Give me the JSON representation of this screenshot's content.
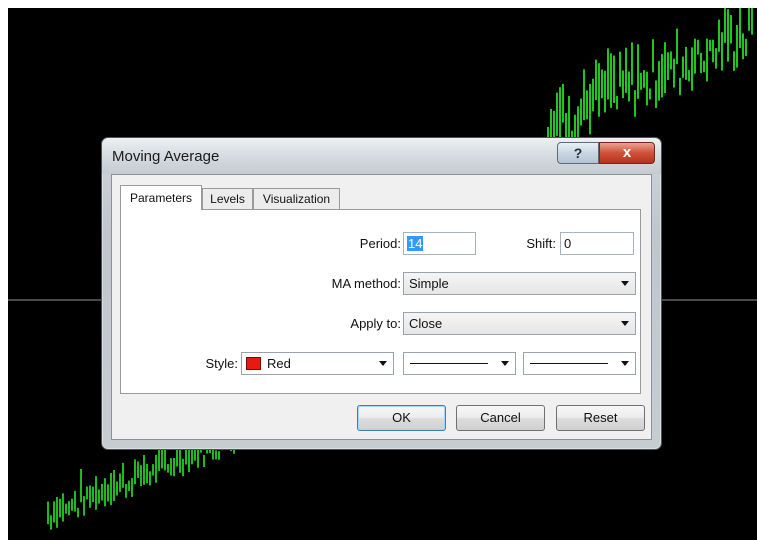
{
  "dialog": {
    "title": "Moving Average",
    "help_label": "?",
    "close_label": "x",
    "tabs": [
      {
        "label": "Parameters",
        "active": true
      },
      {
        "label": "Levels",
        "active": false
      },
      {
        "label": "Visualization",
        "active": false
      }
    ],
    "params": {
      "period_label": "Period:",
      "period_value": "14",
      "shift_label": "Shift:",
      "shift_value": "0",
      "method_label": "MA method:",
      "method_value": "Simple",
      "apply_label": "Apply to:",
      "apply_value": "Close",
      "style_label": "Style:",
      "style_color_name": "Red",
      "style_color": "#e8190f"
    },
    "buttons": {
      "ok": "OK",
      "cancel": "Cancel",
      "reset": "Reset"
    }
  },
  "chart": {
    "background": "#000000",
    "candle_color": "#22dd22"
  }
}
